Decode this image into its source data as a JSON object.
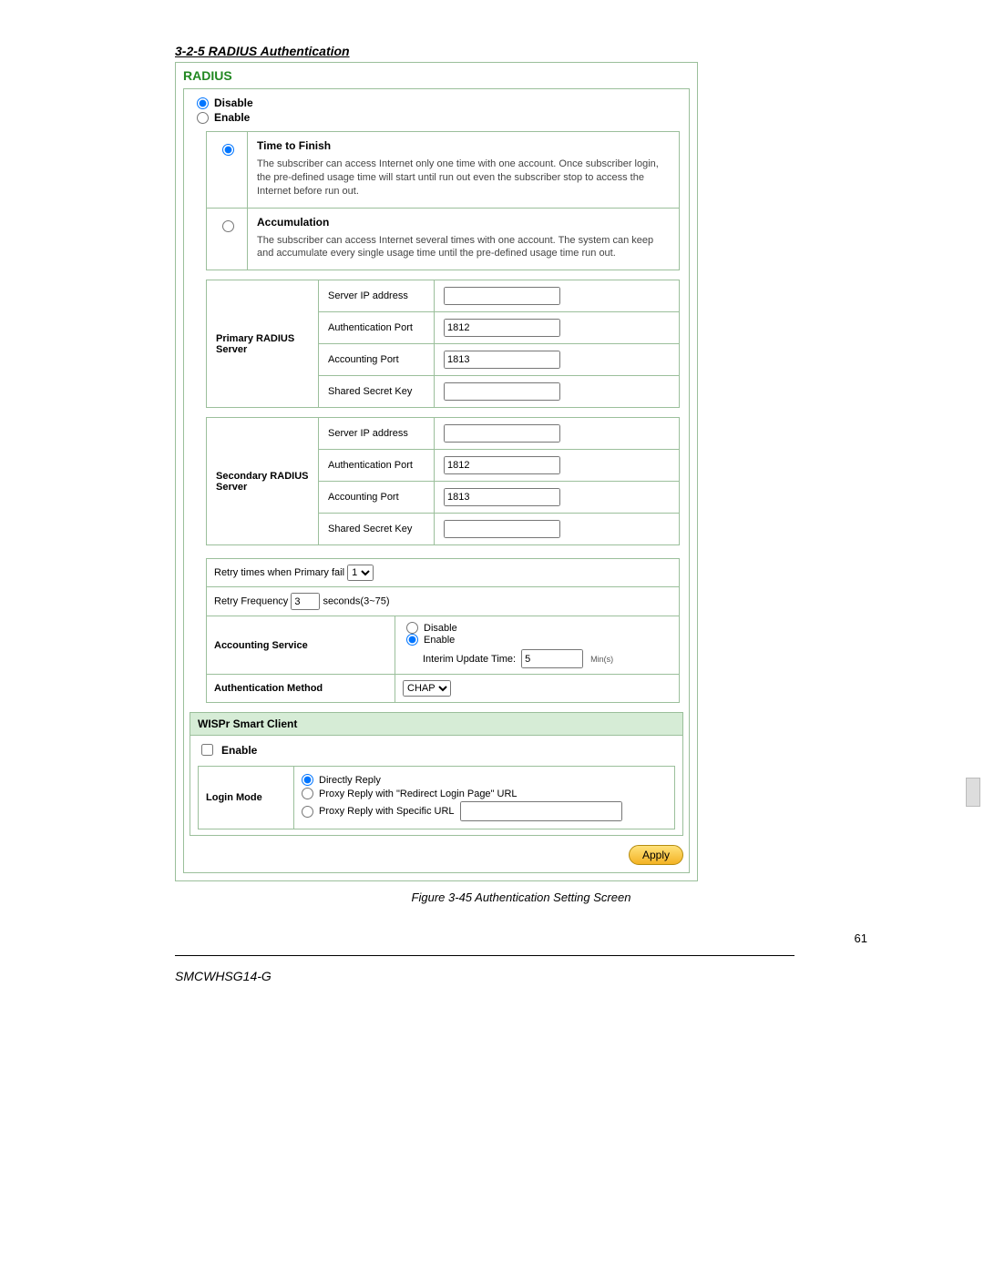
{
  "section_heading": "3-2-5 RADIUS Authentication",
  "panel": {
    "title": "RADIUS",
    "disable_label": "Disable",
    "enable_label": "Enable",
    "modes": {
      "time_to_finish": {
        "title": "Time to Finish",
        "desc": "The subscriber can access Internet only one time with one account.  Once subscriber login, the pre-defined usage time will start until run out even the subscriber stop to access the Internet before run out."
      },
      "accumulation": {
        "title": "Accumulation",
        "desc": "The subscriber can access Internet several times with one account.  The system can keep and accumulate every single usage time until the pre-defined usage time run out."
      }
    },
    "primary": {
      "title": "Primary RADIUS Server",
      "server_ip_label": "Server IP address",
      "auth_port_label": "Authentication Port",
      "auth_port_value": "1812",
      "acct_port_label": "Accounting Port",
      "acct_port_value": "1813",
      "shared_key_label": "Shared Secret Key",
      "server_ip_value": "",
      "shared_key_value": ""
    },
    "secondary": {
      "title": "Secondary RADIUS Server",
      "server_ip_label": "Server IP address",
      "auth_port_label": "Authentication Port",
      "auth_port_value": "1812",
      "acct_port_label": "Accounting Port",
      "acct_port_value": "1813",
      "shared_key_label": "Shared Secret Key",
      "server_ip_value": "",
      "shared_key_value": ""
    },
    "retry_times_label": "Retry times when Primary fail",
    "retry_times_value": "1",
    "retry_freq_label": "Retry Frequency",
    "retry_freq_value": "3",
    "retry_freq_unit": "seconds(3~75)",
    "accounting_service_label": "Accounting Service",
    "accounting": {
      "disable_label": "Disable",
      "enable_label": "Enable",
      "interim_label": "Interim Update Time:",
      "interim_value": "5",
      "interim_unit": "Min(s)"
    },
    "auth_method_label": "Authentication Method",
    "auth_method_value": "CHAP"
  },
  "wispr": {
    "header": "WISPr Smart Client",
    "enable_label": "Enable",
    "login_mode_label": "Login Mode",
    "options": {
      "directly": "Directly Reply",
      "proxy_redirect": "Proxy Reply with \"Redirect Login Page\" URL",
      "proxy_specific": "Proxy Reply with Specific URL",
      "specific_url_value": ""
    }
  },
  "apply_label": "Apply",
  "figure_caption": "Figure 3-45 Authentication Setting Screen",
  "page_number": "61",
  "footer_model": "SMCWHSG14-G"
}
